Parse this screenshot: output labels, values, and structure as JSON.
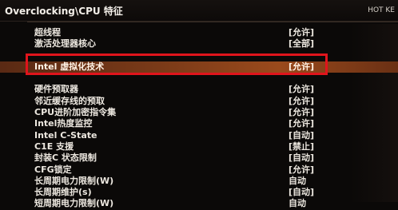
{
  "header": {
    "breadcrumb": "Overclocking\\CPU 特征",
    "hotkey_label": "HOT KE"
  },
  "settings": [
    {
      "name": "超线程",
      "value": "[允许]"
    },
    {
      "name": "激活处理器核心",
      "value": "[全部]"
    },
    {
      "name": "Intel 虚拟化技术",
      "value": "[允许]",
      "selected": true
    },
    {
      "name": "硬件预取器",
      "value": "[允许]"
    },
    {
      "name": "邻近缓存线的预取",
      "value": "[允许]"
    },
    {
      "name": "CPU进阶加密指令集",
      "value": "[允许]"
    },
    {
      "name": "Intel热度监控",
      "value": "[允许]"
    },
    {
      "name": "Intel C-State",
      "value": "[自动]"
    },
    {
      "name": "C1E 支援",
      "value": "[禁止]"
    },
    {
      "name": "封装C 状态限制",
      "value": "[自动]"
    },
    {
      "name": "CFG锁定",
      "value": "[允许]"
    },
    {
      "name": "长周期电力限制(W)",
      "value": "自动"
    },
    {
      "name": "长周期维护(s)",
      "value": "[自动]"
    },
    {
      "name": "短周期电力限制(W)",
      "value": "自动"
    }
  ],
  "colors": {
    "selection": "#8a4218",
    "highlight_border": "#e0141c",
    "background": "#0b0908"
  }
}
